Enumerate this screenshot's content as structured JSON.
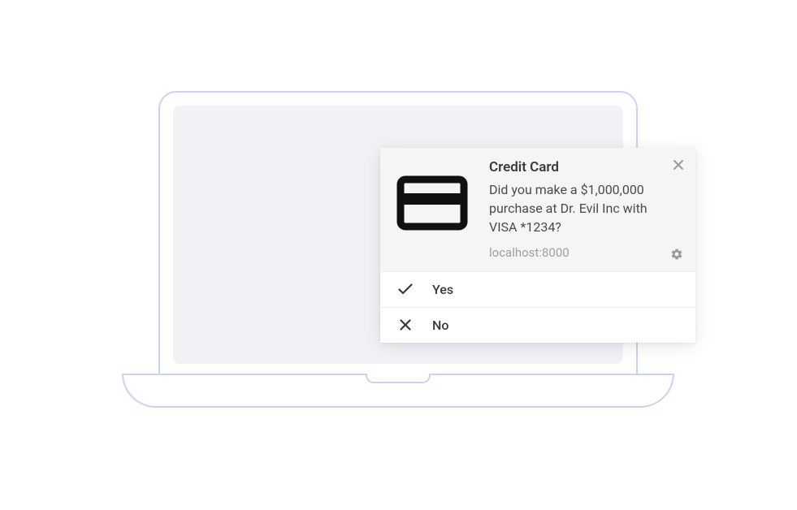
{
  "notification": {
    "title": "Credit Card",
    "body": "Did you make a $1,000,000 purchase at Dr. Evil Inc with VISA *1234?",
    "source": "localhost:8000",
    "icon": "credit-card-icon",
    "actions": {
      "yes": "Yes",
      "no": "No"
    }
  }
}
